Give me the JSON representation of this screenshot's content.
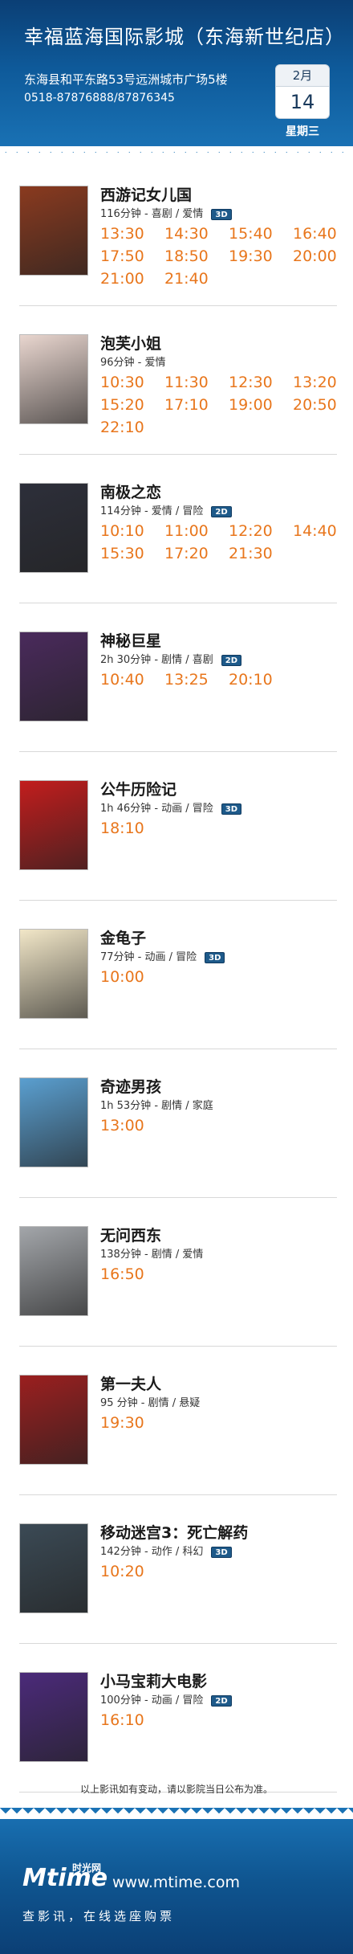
{
  "header": {
    "cinema_name": "幸福蓝海国际影城（东海新世纪店）",
    "address": "东海县和平东路53号远洲城市广场5楼",
    "phone": "0518-87876888/87876345",
    "date": {
      "month": "2月",
      "day": "14",
      "weekday": "星期三"
    }
  },
  "movies": [
    {
      "title": "西游记女儿国",
      "meta": "116分钟 - 喜剧 / 爱情",
      "badge": "3D",
      "poster_color": "#8a3a1f",
      "times": [
        "13:30",
        "14:30",
        "15:40",
        "16:40",
        "17:50",
        "18:50",
        "19:30",
        "20:00",
        "21:00",
        "21:40"
      ]
    },
    {
      "title": "泡芙小姐",
      "meta": "96分钟 - 爱情",
      "badge": "",
      "poster_color": "#e9d6cf",
      "times": [
        "10:30",
        "11:30",
        "12:30",
        "13:20",
        "15:20",
        "17:10",
        "19:00",
        "20:50",
        "22:10"
      ]
    },
    {
      "title": "南极之恋",
      "meta": "114分钟 - 爱情 / 冒险",
      "badge": "2D",
      "poster_color": "#2d2f3a",
      "times": [
        "10:10",
        "11:00",
        "12:20",
        "14:40",
        "15:30",
        "17:20",
        "21:30"
      ]
    },
    {
      "title": "神秘巨星",
      "meta": "2h 30分钟 - 剧情 / 喜剧",
      "badge": "2D",
      "poster_color": "#4a2a5c",
      "times": [
        "10:40",
        "13:25",
        "20:10"
      ]
    },
    {
      "title": "公牛历险记",
      "meta": "1h 46分钟 - 动画 / 冒险",
      "badge": "3D",
      "poster_color": "#c21d1d",
      "times": [
        "18:10"
      ]
    },
    {
      "title": "金龟子",
      "meta": "77分钟 - 动画 / 冒险",
      "badge": "3D",
      "poster_color": "#f2e7c8",
      "times": [
        "10:00"
      ]
    },
    {
      "title": "奇迹男孩",
      "meta": "1h 53分钟 - 剧情 / 家庭",
      "badge": "",
      "poster_color": "#5a9fd0",
      "times": [
        "13:00"
      ]
    },
    {
      "title": "无问西东",
      "meta": "138分钟 - 剧情 / 爱情",
      "badge": "",
      "poster_color": "#a3a6aa",
      "times": [
        "16:50"
      ]
    },
    {
      "title": "第一夫人",
      "meta": "95 分钟 - 剧情 / 悬疑",
      "badge": "",
      "poster_color": "#9b1f1f",
      "times": [
        "19:30"
      ]
    },
    {
      "title": "移动迷宫3：死亡解药",
      "meta": "142分钟 - 动作 / 科幻",
      "badge": "3D",
      "poster_color": "#3b4a55",
      "times": [
        "10:20"
      ]
    },
    {
      "title": "小马宝莉大电影",
      "meta": "100分钟 - 动画 / 冒险",
      "badge": "2D",
      "poster_color": "#4b2a7a",
      "times": [
        "16:10"
      ]
    }
  ],
  "note": "以上影讯如有变动，请以影院当日公布为准。",
  "footer": {
    "logo": "Mtime",
    "logo_cn": "时光网",
    "url": "www.mtime.com",
    "slogan": "查影讯，在线选座购票"
  }
}
